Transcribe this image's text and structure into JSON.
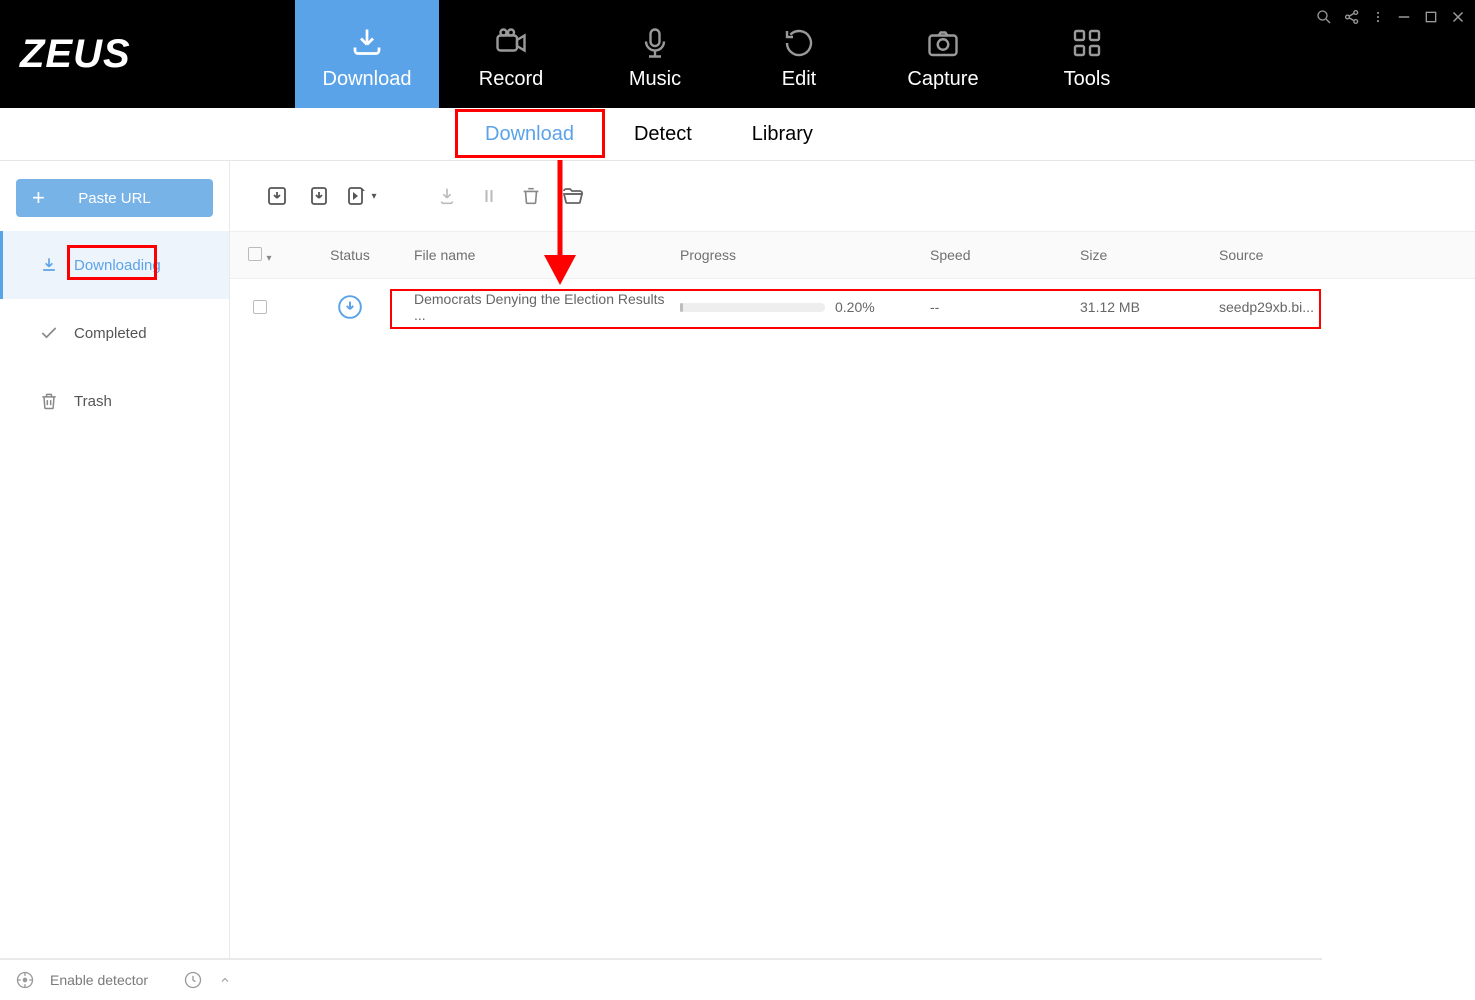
{
  "app": {
    "logo": "ZEUS"
  },
  "topnav": {
    "items": [
      {
        "label": "Download",
        "active": true
      },
      {
        "label": "Record"
      },
      {
        "label": "Music"
      },
      {
        "label": "Edit"
      },
      {
        "label": "Capture"
      },
      {
        "label": "Tools"
      }
    ]
  },
  "subtabs": {
    "items": [
      {
        "label": "Download",
        "active": true
      },
      {
        "label": "Detect"
      },
      {
        "label": "Library"
      }
    ]
  },
  "sidebar": {
    "paste_url_label": "Paste URL",
    "items": [
      {
        "label": "Downloading",
        "active": true
      },
      {
        "label": "Completed"
      },
      {
        "label": "Trash"
      }
    ]
  },
  "columns": {
    "status": "Status",
    "filename": "File name",
    "progress": "Progress",
    "speed": "Speed",
    "size": "Size",
    "source": "Source"
  },
  "rows": [
    {
      "filename": "Democrats Denying the Election Results ...",
      "progress_text": "0.20%",
      "progress_pct": 0.2,
      "speed": "--",
      "size": "31.12 MB",
      "source": "seedp29xb.bi..."
    }
  ],
  "statusbar": {
    "detector": "Enable detector"
  }
}
